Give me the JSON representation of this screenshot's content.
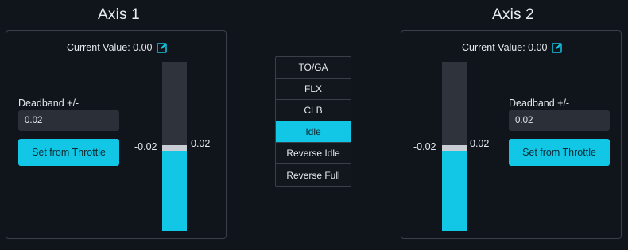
{
  "axes": [
    {
      "title": "Axis 1",
      "current_value_label": "Current Value: 0.00",
      "deadband_label": "Deadband +/-",
      "deadband_value": "0.02",
      "set_button": "Set from Throttle",
      "deadband_low": "-0.02",
      "deadband_high": "0.02",
      "level": 0.48
    },
    {
      "title": "Axis 2",
      "current_value_label": "Current Value: 0.00",
      "deadband_label": "Deadband +/-",
      "deadband_value": "0.02",
      "set_button": "Set from Throttle",
      "deadband_low": "-0.02",
      "deadband_high": "0.02",
      "level": 0.48
    }
  ],
  "detents": {
    "items": [
      "TO/GA",
      "FLX",
      "CLB",
      "Idle",
      "Reverse Idle",
      "Reverse Full"
    ],
    "selected": "Idle"
  },
  "colors": {
    "background": "#10141b",
    "accent": "#12c7e6",
    "panel_border": "#394049",
    "bar_track": "#2f343c",
    "deadband": "#c9cdd3"
  },
  "icons": {
    "edit": "edit-icon"
  }
}
